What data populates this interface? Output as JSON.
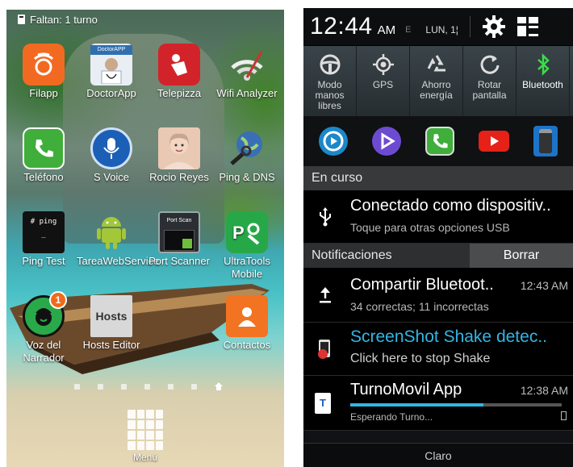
{
  "home": {
    "status_text": "Faltan: 1 turno",
    "apps": [
      {
        "label": "Filapp",
        "icon": "filapp-icon"
      },
      {
        "label": "DoctorApp",
        "icon": "doctorapp-icon"
      },
      {
        "label": "Telepizza",
        "icon": "telepizza-icon"
      },
      {
        "label": "Wifi Analyzer",
        "icon": "wifi-icon"
      },
      {
        "label": "Teléfono",
        "icon": "phone-icon"
      },
      {
        "label": "S Voice",
        "icon": "microphone-icon"
      },
      {
        "label": "Rocio Reyes",
        "icon": "contact-photo-icon"
      },
      {
        "label": "Ping & DNS",
        "icon": "globe-icon"
      },
      {
        "label": "Ping Test",
        "icon": "terminal-icon"
      },
      {
        "label": "TareaWebService",
        "icon": "android-icon"
      },
      {
        "label": "Port Scanner",
        "icon": "port-scan-icon"
      },
      {
        "label": "UltraTools Mobile",
        "icon": "tools-icon"
      },
      {
        "label": "Voz del Narrador",
        "icon": "narrator-icon",
        "badge": "1"
      },
      {
        "label": "Hosts Editor",
        "icon": "hosts-icon"
      },
      {
        "label": "Contactos",
        "icon": "contacts-icon"
      }
    ],
    "ping_icon_text": "# ping _",
    "port_icon_text": "Port Scan",
    "hosts_icon_text": "Hosts",
    "doctor_icon_text": "DoctorAPP",
    "menu_label": "Menú"
  },
  "panel": {
    "time": "12:44",
    "ampm": "AM",
    "carrier_e": "E",
    "date": "LUN, 1¦",
    "toggles": [
      {
        "label": "Modo manos libres",
        "icon": "steering-wheel-icon",
        "on": false
      },
      {
        "label": "GPS",
        "icon": "gps-icon",
        "on": false
      },
      {
        "label": "Ahorro energía",
        "icon": "recycle-icon",
        "on": false
      },
      {
        "label": "Rotar pantalla",
        "icon": "rotate-icon",
        "on": false
      },
      {
        "label": "Bluetooth",
        "icon": "bluetooth-icon",
        "on": true
      }
    ],
    "ongoing_header": "En curso",
    "usb": {
      "title": "Conectado como dispositiv..",
      "subtitle": "Toque para otras opciones USB"
    },
    "notifications_header": "Notificaciones",
    "clear_label": "Borrar",
    "bluetooth_share": {
      "title": "Compartir Bluetoot..",
      "time": "12:43 AM",
      "subtitle": "34 correctas; 11 incorrectas"
    },
    "screenshot_shake": {
      "title": "ScreenShot Shake detec..",
      "subtitle": "Click here to stop Shake"
    },
    "turnomovil": {
      "title": "TurnoMovil App",
      "time": "12:38 AM",
      "subtitle": "Esperando Turno...",
      "progress": 0.63
    },
    "footer_label": "Claro",
    "colors": {
      "accent": "#33b5e5",
      "bluetooth": "#3ddc4a",
      "progress": "#33b5e5"
    }
  }
}
